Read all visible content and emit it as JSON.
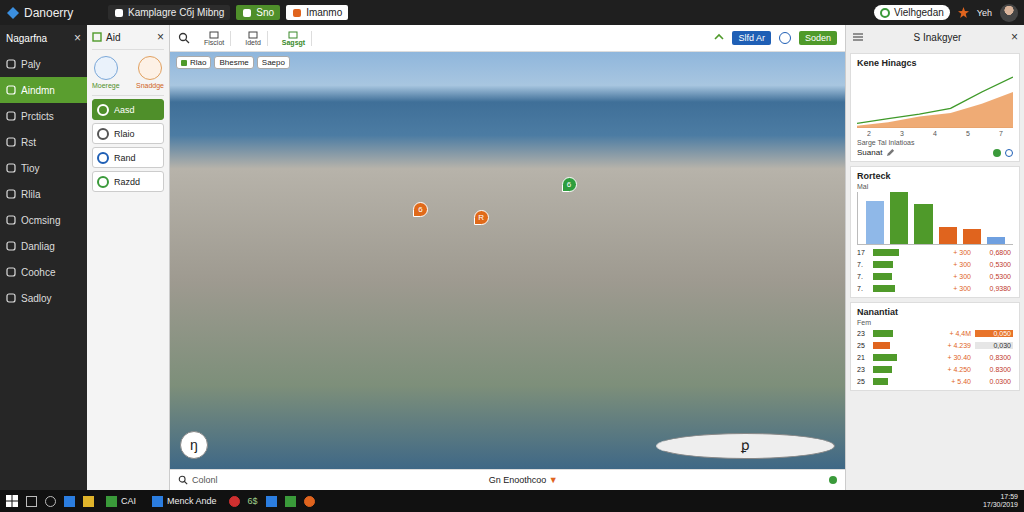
{
  "topbar": {
    "app_name": "Danoerry",
    "items": [
      {
        "label": "Kamplagre Cбj Mibng",
        "kind": "tab"
      },
      {
        "label": "Sno",
        "kind": "button"
      },
      {
        "label": "Imanmo",
        "kind": "box"
      }
    ],
    "user": "Vielhgedan",
    "extra": "Yeh"
  },
  "sidebar": {
    "title": "Nagarfna",
    "close": "×",
    "items": [
      {
        "label": "Paly",
        "selected": false
      },
      {
        "label": "Aindmn",
        "selected": true
      },
      {
        "label": "Prcticts",
        "selected": false
      },
      {
        "label": "Rst",
        "selected": false
      },
      {
        "label": "Tioy",
        "selected": false
      },
      {
        "label": "Rlila",
        "selected": false
      },
      {
        "label": "Ocmsing",
        "selected": false
      },
      {
        "label": "Danliag",
        "selected": false
      },
      {
        "label": "Coohce",
        "selected": false
      },
      {
        "label": "Sadloy",
        "selected": false
      }
    ]
  },
  "panel": {
    "title": "Aid",
    "close": "×",
    "tools": [
      "Moerege",
      "Snaddge"
    ],
    "items": [
      {
        "label": "Aasd",
        "selected": true,
        "color": "#5a9e2f"
      },
      {
        "label": "Rlaio",
        "selected": false,
        "color": "#555555"
      },
      {
        "label": "Rand",
        "selected": false,
        "color": "#1f5fb5"
      },
      {
        "label": "Razdd",
        "selected": false,
        "color": "#3a9a3a"
      }
    ]
  },
  "toolbar": {
    "tools": [
      {
        "label": "Fisciot",
        "active": false
      },
      {
        "label": "Idetd",
        "active": false
      },
      {
        "label": "Sagsgt",
        "active": true
      }
    ],
    "buttons": [
      {
        "label": "Slfd Ar",
        "kind": "primary"
      },
      {
        "label": "Soden",
        "kind": "success"
      }
    ]
  },
  "map": {
    "chips": [
      "Rlao",
      "Bhesme",
      "Saepo"
    ],
    "pins": [
      {
        "label": "6",
        "color": "#e06a1a"
      },
      {
        "label": "R",
        "color": "#e06a1a"
      },
      {
        "label": "6",
        "color": "#2e9e3e"
      }
    ],
    "corner_left": "ŋ",
    "corner_right": "ꝑ"
  },
  "status": {
    "left": "Colonl",
    "center": "Gn Enoothcoo",
    "center_icon": "▼"
  },
  "right": {
    "title": "S Inakgyer",
    "close": "×",
    "line_chart": {
      "title": "Kene Hinagcs",
      "x_ticks": [
        "2",
        "3",
        "4",
        "5",
        "7"
      ],
      "series": [
        {
          "color": "#e8883a",
          "values": [
            4,
            10,
            20,
            26,
            42,
            62
          ]
        },
        {
          "color": "#3f9a2a",
          "values": [
            8,
            16,
            24,
            34,
            62,
            88
          ]
        }
      ],
      "caption": "Sarge Tal Inlatioas",
      "summary": "Suanat"
    },
    "bar_chart": {
      "title": "Rorteck",
      "axis_label": "Mal",
      "bars": [
        {
          "value": 45,
          "color": "#8fb8e8"
        },
        {
          "value": 55,
          "color": "#4f9a2a"
        },
        {
          "value": 42,
          "color": "#4f9a2a"
        },
        {
          "value": 18,
          "color": "#e0641e"
        },
        {
          "value": 16,
          "color": "#e0641e"
        },
        {
          "value": 7,
          "color": "#6fa0e0"
        }
      ],
      "rows": [
        {
          "label": "17",
          "level": 0.75,
          "delta": "+ 300",
          "value": "0,6800"
        },
        {
          "label": "7.",
          "level": 0.6,
          "delta": "+ 300",
          "value": "0,5300"
        },
        {
          "label": "7.",
          "level": 0.55,
          "delta": "+ 300",
          "value": "0,5300"
        },
        {
          "label": "7.",
          "level": 0.65,
          "delta": "+ 300",
          "value": "0,9380"
        }
      ]
    },
    "table": {
      "title": "Nanantiat",
      "column": "Fem",
      "rows": [
        {
          "label": "23",
          "level": 0.6,
          "color": "#4f9a2a",
          "delta": "+ 4,4M",
          "value": "0,050",
          "kind": "badge"
        },
        {
          "label": "25",
          "level": 0.5,
          "color": "#e0641e",
          "delta": "+ 4.239",
          "value": "0,030",
          "kind": "tag"
        },
        {
          "label": "21",
          "level": 0.7,
          "color": "#4f9a2a",
          "delta": "+ 30.40",
          "value": "0,8300",
          "kind": "plain"
        },
        {
          "label": "23",
          "level": 0.55,
          "color": "#4f9a2a",
          "delta": "+ 4.250",
          "value": "0.8300",
          "kind": "plain"
        },
        {
          "label": "25",
          "level": 0.45,
          "color": "#4f9a2a",
          "delta": "+ 5.40",
          "value": "0.0300",
          "kind": "plain"
        }
      ]
    }
  },
  "taskbar": {
    "apps": [
      "CAI",
      "Menck Ande"
    ],
    "tray": "6$",
    "time": "17:59",
    "date": "17/30/2019"
  }
}
